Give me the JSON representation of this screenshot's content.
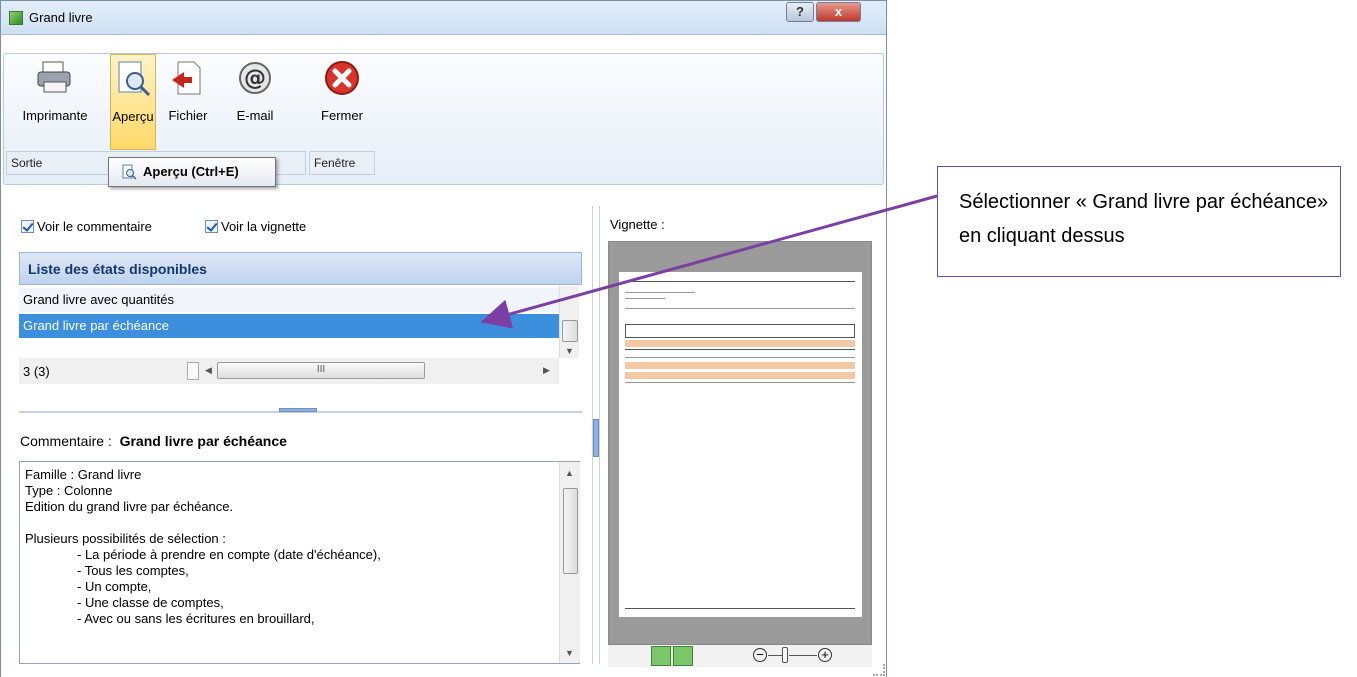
{
  "window": {
    "title": "Grand livre",
    "help_label": "?",
    "close_label": "x"
  },
  "ribbon": {
    "buttons": [
      {
        "label": "Imprimante",
        "icon": "printer-icon"
      },
      {
        "label": "Aperçu",
        "icon": "preview-icon"
      },
      {
        "label": "Fichier",
        "icon": "file-export-icon"
      },
      {
        "label": "E-mail",
        "icon": "email-icon"
      },
      {
        "label": "Fermer",
        "icon": "close-red-icon"
      }
    ],
    "groups": {
      "sortie": "Sortie",
      "fenetre": "Fenêtre"
    },
    "tooltip": "Aperçu (Ctrl+E)"
  },
  "options": {
    "voir_commentaire": "Voir le commentaire",
    "voir_vignette": "Voir la vignette"
  },
  "list": {
    "header": "Liste des états disponibles",
    "items": [
      "Grand livre avec quantités",
      "Grand livre par échéance"
    ],
    "count": "3 (3)",
    "hscroll_label": "III"
  },
  "comment": {
    "label": "Commentaire :",
    "title": "Grand livre par échéance",
    "lines": [
      "Famille : Grand livre",
      "Type : Colonne",
      "Edition du grand livre par échéance.",
      "",
      "Plusieurs possibilités de sélection :"
    ],
    "indented": [
      "- La période à prendre en compte (date d'échéance),",
      "- Tous les comptes,",
      "- Un compte,",
      "- Une classe de comptes,",
      "- Avec ou sans les écritures en brouillard,"
    ]
  },
  "vignette": {
    "label": "Vignette :"
  },
  "callout": {
    "text": "Sélectionner « Grand livre par échéance» en cliquant dessus"
  },
  "colors": {
    "selection": "#3c8fdc",
    "callout_border": "#6d4a9e",
    "arrow": "#7b3fa3"
  }
}
